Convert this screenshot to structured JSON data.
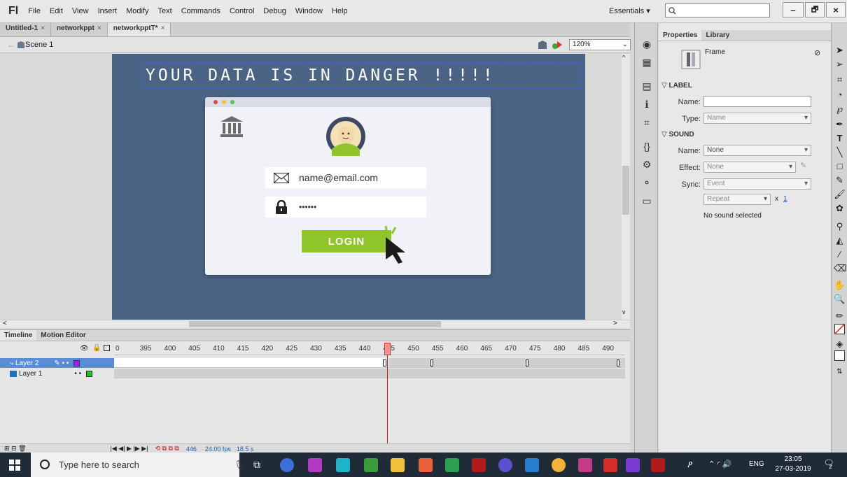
{
  "app": {
    "logo": "Fl",
    "menu": [
      "File",
      "Edit",
      "View",
      "Insert",
      "Modify",
      "Text",
      "Commands",
      "Control",
      "Debug",
      "Window",
      "Help"
    ],
    "workspace": "Essentials",
    "search_placeholder": "",
    "win_minimize": "–",
    "win_maximize": "🗗",
    "win_close": "×"
  },
  "doc_tabs": [
    {
      "label": "Untitled-1",
      "close": "×"
    },
    {
      "label": "networkppt",
      "close": "×"
    },
    {
      "label": "networkpptT*",
      "close": "×"
    }
  ],
  "editbar": {
    "scene": "Scene 1",
    "zoom": "120%"
  },
  "stage": {
    "headline": "YOUR DATA IS IN DANGER !!!!!",
    "email": "name@email.com",
    "password": "••••••",
    "login": "LOGIN"
  },
  "timeline": {
    "tabs": [
      "Timeline",
      "Motion Editor"
    ],
    "ticks": [
      "0",
      "395",
      "400",
      "405",
      "410",
      "415",
      "420",
      "425",
      "430",
      "435",
      "440",
      "445",
      "450",
      "455",
      "460",
      "465",
      "470",
      "475",
      "480",
      "485",
      "490"
    ],
    "layers": [
      {
        "name": "Layer 2",
        "color": "#a020f0"
      },
      {
        "name": "Layer 1",
        "color": "#20c020"
      }
    ],
    "frame": "446",
    "fps": "24.00 fps",
    "seconds": "18.5 s"
  },
  "properties": {
    "tabs": [
      "Properties",
      "Library"
    ],
    "frame_label": "Frame",
    "label_section": "LABEL",
    "name_label": "Name:",
    "type_label": "Type:",
    "type_value": "Name",
    "sound_section": "SOUND",
    "sound_name_label": "Name:",
    "sound_name_value": "None",
    "effect_label": "Effect:",
    "effect_value": "None",
    "sync_label": "Sync:",
    "sync_value": "Event",
    "repeat_value": "Repeat",
    "repeat_x": "x",
    "repeat_count": "1",
    "no_sound": "No sound selected"
  },
  "taskbar": {
    "search_placeholder": "Type here to search",
    "lang": "ENG",
    "time": "23:05",
    "date": "27-03-2019",
    "notif_count": "2"
  }
}
